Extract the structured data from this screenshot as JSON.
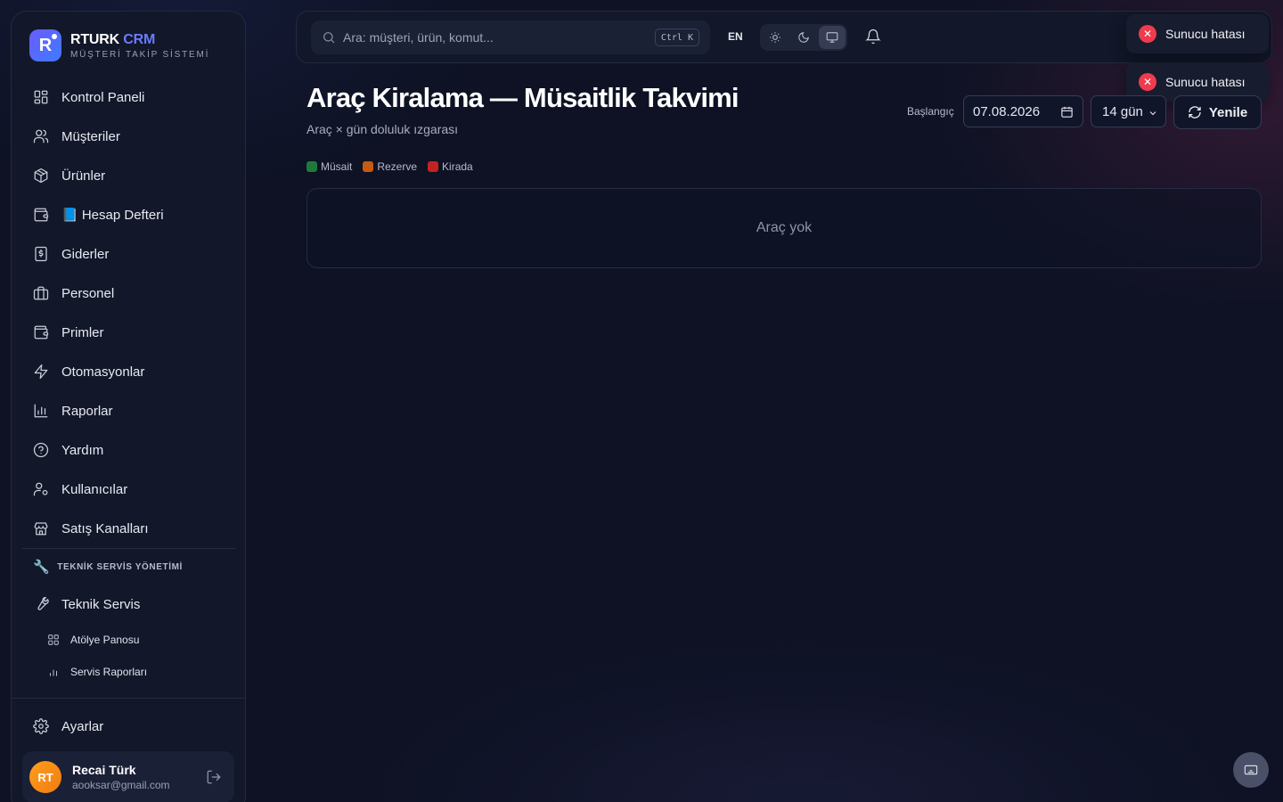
{
  "brand": {
    "name": "RTURK",
    "name_accent": "CRM",
    "tagline": "MÜŞTERİ TAKİP SİSTEMİ",
    "logo_letter": "R"
  },
  "sidebar": {
    "items": [
      {
        "label": "Kontrol Paneli",
        "icon": "dashboard-icon"
      },
      {
        "label": "Müşteriler",
        "icon": "users-icon"
      },
      {
        "label": "Ürünler",
        "icon": "box-icon"
      },
      {
        "label": "📘 Hesap Defteri",
        "icon": "wallet-icon"
      },
      {
        "label": "Giderler",
        "icon": "receipt-icon"
      },
      {
        "label": "Personel",
        "icon": "briefcase-icon"
      },
      {
        "label": "Primler",
        "icon": "wallet-icon"
      },
      {
        "label": "Otomasyonlar",
        "icon": "lightning-icon"
      },
      {
        "label": "Raporlar",
        "icon": "bar-chart-icon"
      },
      {
        "label": "Yardım",
        "icon": "help-icon"
      },
      {
        "label": "Kullanıcılar",
        "icon": "user-cog-icon"
      },
      {
        "label": "Satış Kanalları",
        "icon": "store-icon"
      }
    ],
    "section": {
      "title": "TEKNİK SERVİS YÖNETİMİ",
      "icon": "wrench-icon",
      "item": {
        "label": "Teknik Servis",
        "icon": "wrench-icon"
      },
      "sub_items": [
        {
          "label": "Atölye Panosu",
          "icon": "grid-icon"
        },
        {
          "label": "Servis Raporları",
          "icon": "bar-chart-icon"
        }
      ]
    },
    "settings_label": "Ayarlar",
    "user": {
      "initials": "RT",
      "name": "Recai Türk",
      "email": "aooksar@gmail.com"
    }
  },
  "topbar": {
    "search_placeholder": "Ara: müşteri, ürün, komut...",
    "shortcut": "Ctrl K",
    "language": "EN",
    "theme_active": "system"
  },
  "toasts": [
    {
      "message": "Sunucu hatası",
      "type": "error"
    },
    {
      "message": "Sunucu hatası",
      "type": "error"
    }
  ],
  "page": {
    "title": "Araç Kiralama — Müsaitlik Takvimi",
    "subtitle": "Araç × gün doluluk ızgarası",
    "start_label": "Başlangıç",
    "start_date": "07.08.2026",
    "range": "14 gün",
    "refresh_label": "Yenile",
    "legend": [
      {
        "label": "Müsait",
        "color": "#1f7a3a"
      },
      {
        "label": "Rezerve",
        "color": "#c65a10"
      },
      {
        "label": "Kirada",
        "color": "#c42222"
      }
    ],
    "empty_message": "Araç yok"
  }
}
